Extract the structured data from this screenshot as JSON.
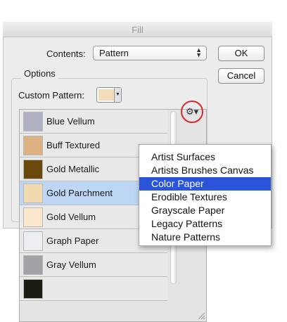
{
  "dialog": {
    "title": "Fill",
    "contents_label": "Contents:",
    "contents_value": "Pattern",
    "ok_label": "OK",
    "cancel_label": "Cancel",
    "options_label": "Options",
    "custom_pattern_label": "Custom Pattern:",
    "swatch_color": "#f2dcb8"
  },
  "patterns": [
    {
      "name": "Blue Vellum",
      "color": "#aeb1c2",
      "selected": false
    },
    {
      "name": "Buff Textured",
      "color": "#ddb282",
      "selected": false
    },
    {
      "name": "Gold Metallic",
      "color": "#6a4a0c",
      "selected": false
    },
    {
      "name": "Gold Parchment",
      "color": "#f1d9b2",
      "selected": true
    },
    {
      "name": "Gold Vellum",
      "color": "#fbe8cd",
      "selected": false
    },
    {
      "name": "Graph Paper",
      "color": "#eceef2",
      "selected": false
    },
    {
      "name": "Gray Vellum",
      "color": "#a3a3a7",
      "selected": false
    },
    {
      "name": "",
      "color": "#1c1c12",
      "selected": false
    }
  ],
  "gear_icon": "gear-icon",
  "menu": {
    "items": [
      {
        "label": "Artist Surfaces",
        "highlighted": false
      },
      {
        "label": "Artists Brushes Canvas",
        "highlighted": false
      },
      {
        "label": "Color Paper",
        "highlighted": true
      },
      {
        "label": "Erodible Textures",
        "highlighted": false
      },
      {
        "label": "Grayscale Paper",
        "highlighted": false
      },
      {
        "label": "Legacy Patterns",
        "highlighted": false
      },
      {
        "label": "Nature Patterns",
        "highlighted": false
      }
    ],
    "highlight_color": "#2a55d9"
  }
}
